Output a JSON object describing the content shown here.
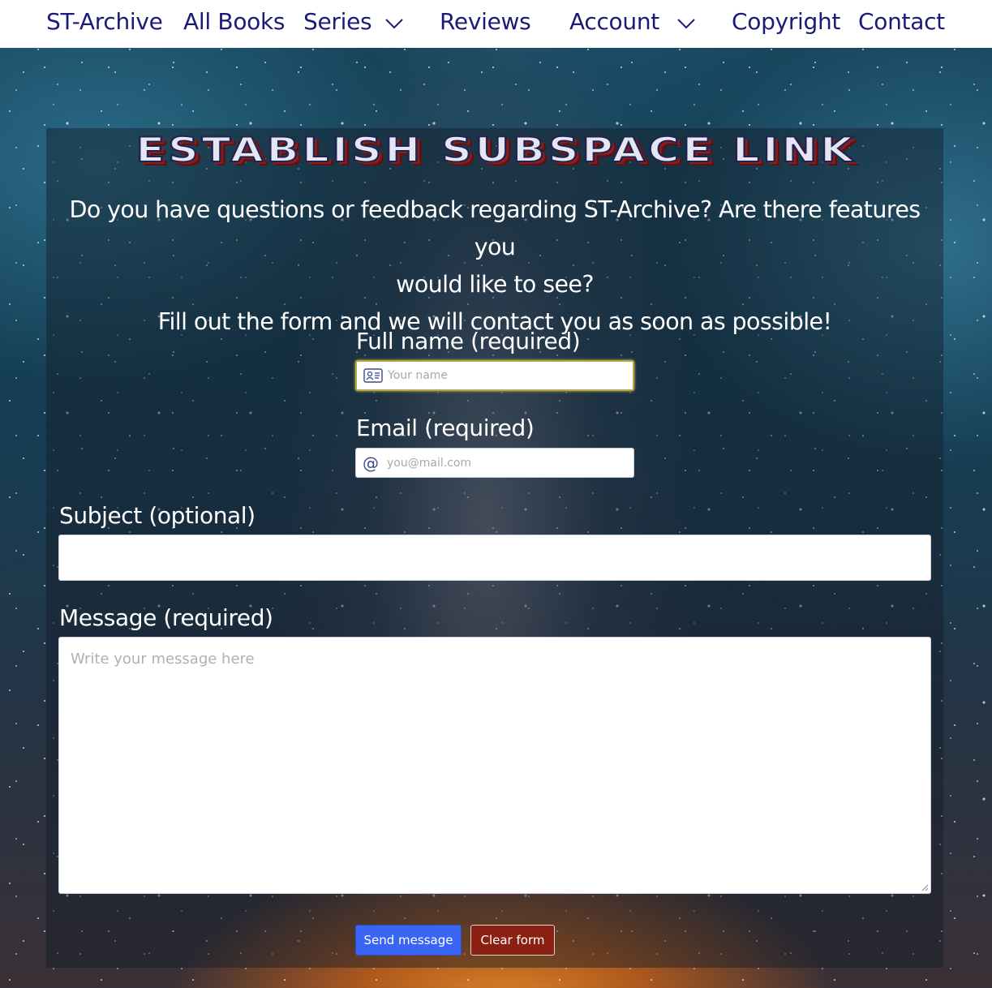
{
  "nav": {
    "brand": "ST-Archive",
    "items": [
      {
        "label": "All Books"
      },
      {
        "label": "Series"
      },
      {
        "label": "Reviews"
      },
      {
        "label": "Account"
      },
      {
        "label": "Copyright"
      },
      {
        "label": "Contact"
      }
    ]
  },
  "page": {
    "heading": "ESTABLISH SUBSPACE LINK",
    "intro_line1": "Do you have questions or feedback regarding ST-Archive? Are there features you",
    "intro_line2": "would like to see?",
    "intro_line3": "Fill out the form and we will contact you as soon as possible!"
  },
  "form": {
    "name": {
      "label": "Full name (required)",
      "placeholder": "Your name",
      "value": "",
      "icon": "id-card-icon"
    },
    "email": {
      "label": "Email (required)",
      "placeholder": "you@mail.com",
      "value": "",
      "icon": "at-icon",
      "icon_glyph": "@"
    },
    "subject": {
      "label": "Subject (optional)",
      "placeholder": "",
      "value": ""
    },
    "message": {
      "label": "Message (required)",
      "placeholder": "Write your message here",
      "value": ""
    },
    "send_label": "Send message",
    "clear_label": "Clear form"
  },
  "colors": {
    "nav_text": "#1a1a7a",
    "send_button": "#3a64f4",
    "clear_button": "#8a1f12",
    "focus_border": "#b8a640"
  }
}
